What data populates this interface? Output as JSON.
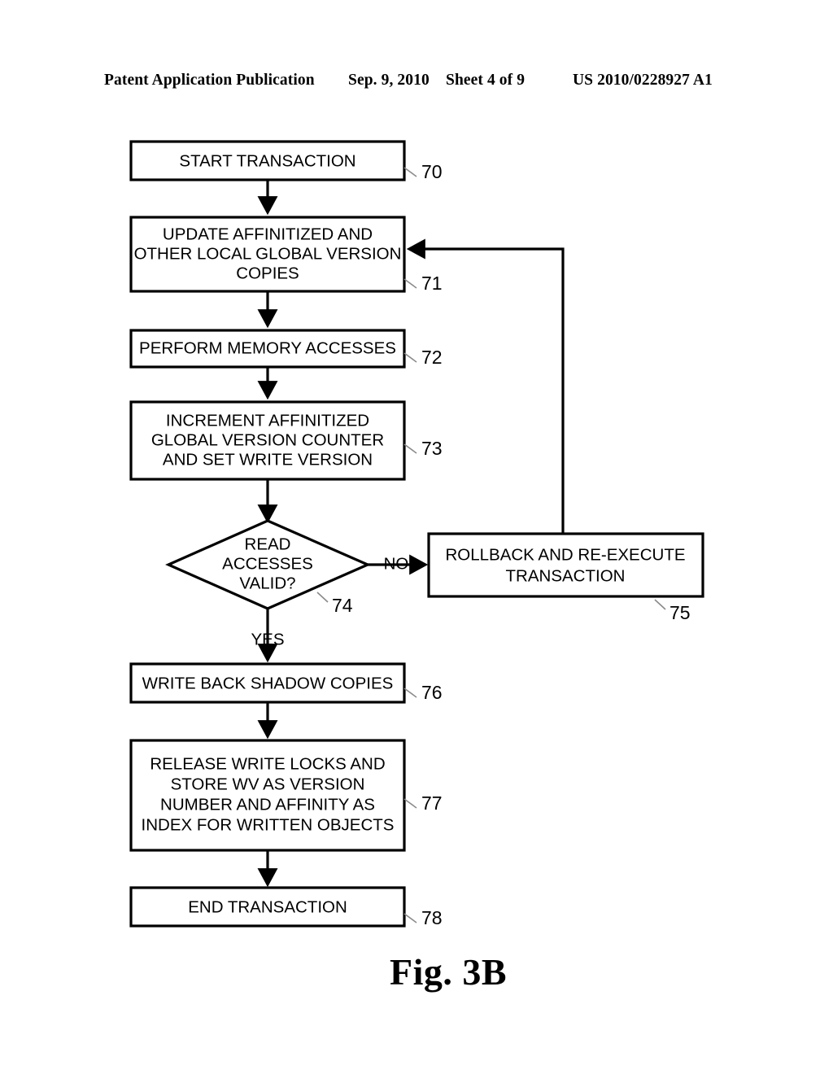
{
  "header": {
    "publication": "Patent Application Publication",
    "date": "Sep. 9, 2010",
    "sheet": "Sheet 4 of 9",
    "patent_number": "US 2010/0228927 A1"
  },
  "figure": {
    "caption": "Fig. 3B"
  },
  "flowchart": {
    "nodes": {
      "start": {
        "ref": "70",
        "lines": [
          "START TRANSACTION"
        ]
      },
      "update_versions": {
        "ref": "71",
        "lines": [
          "UPDATE AFFINITIZED AND",
          "OTHER LOCAL GLOBAL VERSION",
          "COPIES"
        ]
      },
      "memory_accesses": {
        "ref": "72",
        "lines": [
          "PERFORM MEMORY ACCESSES"
        ]
      },
      "increment_counter": {
        "ref": "73",
        "lines": [
          "INCREMENT AFFINITIZED",
          "GLOBAL VERSION COUNTER",
          "AND SET WRITE VERSION"
        ]
      },
      "decision_reads_valid": {
        "ref": "74",
        "lines": [
          "READ",
          "ACCESSES",
          "VALID?"
        ]
      },
      "rollback": {
        "ref": "75",
        "lines": [
          "ROLLBACK AND RE-EXECUTE",
          "TRANSACTION"
        ]
      },
      "write_back": {
        "ref": "76",
        "lines": [
          "WRITE BACK SHADOW COPIES"
        ]
      },
      "release_locks": {
        "ref": "77",
        "lines": [
          "RELEASE WRITE LOCKS AND",
          "STORE WV AS VERSION",
          "NUMBER AND AFFINITY AS",
          "INDEX FOR WRITTEN OBJECTS"
        ]
      },
      "end": {
        "ref": "78",
        "lines": [
          "END TRANSACTION"
        ]
      }
    },
    "branch_labels": {
      "no": "NO",
      "yes": "YES"
    }
  }
}
